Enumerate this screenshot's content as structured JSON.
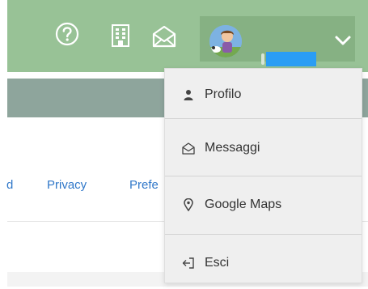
{
  "colors": {
    "header_green": "#98c296",
    "user_menu_green": "#86b183",
    "gray_bar": "#8ea59c",
    "link_blue": "#2f77c9",
    "dropdown_bg": "#efefef",
    "redaction": "#2a9df4"
  },
  "header": {
    "icons": [
      "help-icon",
      "building-icon",
      "envelope-open-icon"
    ],
    "user_menu": {
      "avatar": "avatar",
      "chevron": "chevron-down-icon"
    }
  },
  "footer": {
    "links": [
      {
        "label": "d"
      },
      {
        "label": "Privacy"
      },
      {
        "label": "Prefe"
      }
    ]
  },
  "dropdown": {
    "items": [
      {
        "label": "Profilo",
        "icon": "user-icon"
      },
      {
        "label": "Messaggi",
        "icon": "envelope-open-icon"
      },
      {
        "label": "Google Maps",
        "icon": "map-marker-icon"
      },
      {
        "label": "Esci",
        "icon": "sign-out-icon"
      }
    ]
  }
}
